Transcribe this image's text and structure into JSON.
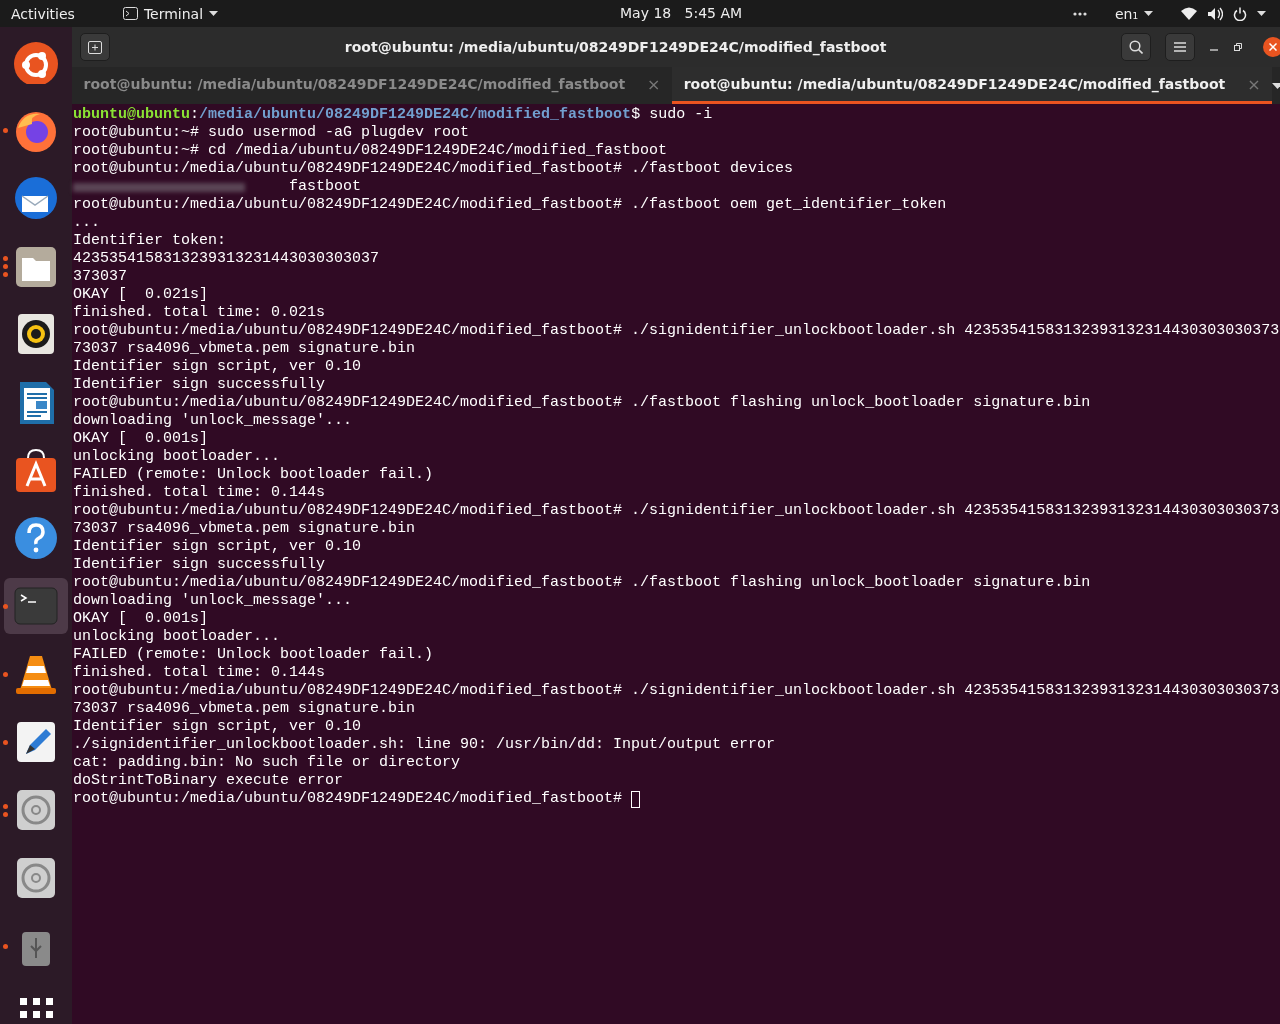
{
  "top_bar": {
    "activities": "Activities",
    "app_menu": "Terminal",
    "clock": "May 18   5:45 AM",
    "input_source": "en₁"
  },
  "dock": {
    "items": [
      {
        "kind": "ubuntu",
        "selected": false
      },
      {
        "kind": "firefox",
        "indicators": [
          true
        ],
        "selected": false
      },
      {
        "kind": "mail",
        "selected": false
      },
      {
        "kind": "files",
        "indicators": [
          true,
          true,
          true
        ],
        "selected": false
      },
      {
        "kind": "speaker",
        "selected": false
      },
      {
        "kind": "document",
        "selected": false
      },
      {
        "kind": "store",
        "selected": false
      },
      {
        "kind": "help",
        "selected": false
      },
      {
        "kind": "terminal",
        "indicators": [
          true
        ],
        "selected": true
      },
      {
        "kind": "cone",
        "indicators": [
          true
        ],
        "selected": false
      },
      {
        "kind": "editor",
        "indicators": [
          true
        ],
        "selected": false
      },
      {
        "kind": "disc",
        "indicators": [
          true,
          true
        ],
        "selected": false
      },
      {
        "kind": "disc",
        "selected": false
      },
      {
        "kind": "usb",
        "indicators": [
          true
        ],
        "selected": false
      },
      {
        "kind": "apps",
        "selected": false
      }
    ]
  },
  "window": {
    "title": "root@ubuntu: /media/ubuntu/08249DF1249DE24C/modified_fastboot"
  },
  "tabs": [
    {
      "label": "root@ubuntu: /media/ubuntu/08249DF1249DE24C/modified_fastboot",
      "close": "×",
      "selected": false
    },
    {
      "label": "root@ubuntu: /media/ubuntu/08249DF1249DE24C/modified_fastboot",
      "close": "×",
      "selected": true
    }
  ],
  "terminal": {
    "lines": [
      {
        "kind": "user_prompt",
        "user": "ubuntu@ubuntu",
        "sep": ":",
        "path": "/media/ubuntu/08249DF1249DE24C/modified_fastboot",
        "command": "$ sudo -i"
      },
      {
        "kind": "text",
        "text": "root@ubuntu:~# sudo usermod -aG plugdev root"
      },
      {
        "kind": "text",
        "text": "root@ubuntu:~# cd /media/ubuntu/08249DF1249DE24C/modified_fastboot"
      },
      {
        "kind": "text",
        "text": "root@ubuntu:/media/ubuntu/08249DF1249DE24C/modified_fastboot# ./fastboot devices"
      },
      {
        "kind": "redacted",
        "text": "fastboot"
      },
      {
        "kind": "text",
        "text": "root@ubuntu:/media/ubuntu/08249DF1249DE24C/modified_fastboot# ./fastboot oem get_identifier_token"
      },
      {
        "kind": "text",
        "text": "..."
      },
      {
        "kind": "text",
        "text": "Identifier token:"
      },
      {
        "kind": "text",
        "text": "4235354158313239313231443030303037"
      },
      {
        "kind": "text",
        "text": "373037"
      },
      {
        "kind": "text",
        "text": "OKAY [  0.021s]"
      },
      {
        "kind": "text",
        "text": "finished. total time: 0.021s"
      },
      {
        "kind": "text",
        "text": "root@ubuntu:/media/ubuntu/08249DF1249DE24C/modified_fastboot# ./signidentifier_unlockbootloader.sh 42353541583132393132314430303030373"
      },
      {
        "kind": "text",
        "text": "73037 rsa4096_vbmeta.pem signature.bin"
      },
      {
        "kind": "text",
        "text": "Identifier sign script, ver 0.10"
      },
      {
        "kind": "text",
        "text": "Identifier sign successfully"
      },
      {
        "kind": "text",
        "text": "root@ubuntu:/media/ubuntu/08249DF1249DE24C/modified_fastboot# ./fastboot flashing unlock_bootloader signature.bin"
      },
      {
        "kind": "text",
        "text": "downloading 'unlock_message'..."
      },
      {
        "kind": "text",
        "text": "OKAY [  0.001s]"
      },
      {
        "kind": "text",
        "text": "unlocking bootloader..."
      },
      {
        "kind": "text",
        "text": "FAILED (remote: Unlock bootloader fail.)"
      },
      {
        "kind": "text",
        "text": "finished. total time: 0.144s"
      },
      {
        "kind": "text",
        "text": "root@ubuntu:/media/ubuntu/08249DF1249DE24C/modified_fastboot# ./signidentifier_unlockbootloader.sh 42353541583132393132314430303030373"
      },
      {
        "kind": "text",
        "text": "73037 rsa4096_vbmeta.pem signature.bin"
      },
      {
        "kind": "text",
        "text": "Identifier sign script, ver 0.10"
      },
      {
        "kind": "text",
        "text": "Identifier sign successfully"
      },
      {
        "kind": "text",
        "text": "root@ubuntu:/media/ubuntu/08249DF1249DE24C/modified_fastboot# ./fastboot flashing unlock_bootloader signature.bin"
      },
      {
        "kind": "text",
        "text": "downloading 'unlock_message'..."
      },
      {
        "kind": "text",
        "text": "OKAY [  0.001s]"
      },
      {
        "kind": "text",
        "text": "unlocking bootloader..."
      },
      {
        "kind": "text",
        "text": "FAILED (remote: Unlock bootloader fail.)"
      },
      {
        "kind": "text",
        "text": "finished. total time: 0.144s"
      },
      {
        "kind": "text",
        "text": "root@ubuntu:/media/ubuntu/08249DF1249DE24C/modified_fastboot# ./signidentifier_unlockbootloader.sh 42353541583132393132314430303030373"
      },
      {
        "kind": "text",
        "text": "73037 rsa4096_vbmeta.pem signature.bin"
      },
      {
        "kind": "text",
        "text": "Identifier sign script, ver 0.10"
      },
      {
        "kind": "text",
        "text": "./signidentifier_unlockbootloader.sh: line 90: /usr/bin/dd: Input/output error"
      },
      {
        "kind": "text",
        "text": "cat: padding.bin: No such file or directory"
      },
      {
        "kind": "text",
        "text": "doStrintToBinary execute error"
      },
      {
        "kind": "cursor",
        "text": "root@ubuntu:/media/ubuntu/08249DF1249DE24C/modified_fastboot# "
      }
    ]
  }
}
